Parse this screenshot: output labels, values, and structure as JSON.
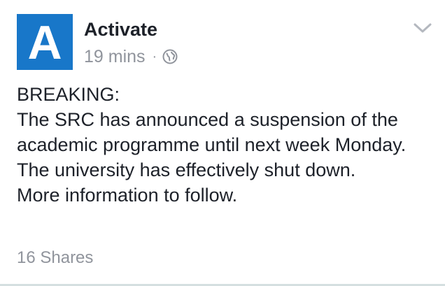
{
  "post": {
    "avatar_letter": "A",
    "page_name": "Activate",
    "timestamp": "19 mins",
    "separator": "·",
    "privacy_icon": "globe-icon",
    "menu_icon": "chevron-down-icon",
    "body_lines": [
      "BREAKING:",
      "The SRC has announced a suspension of the academic programme until next week Monday. The university has effectively shut down.",
      "More information to follow."
    ],
    "shares": "16 Shares"
  },
  "colors": {
    "avatar_bg": "#1877c9",
    "text": "#1d2129",
    "muted": "#90949c"
  }
}
